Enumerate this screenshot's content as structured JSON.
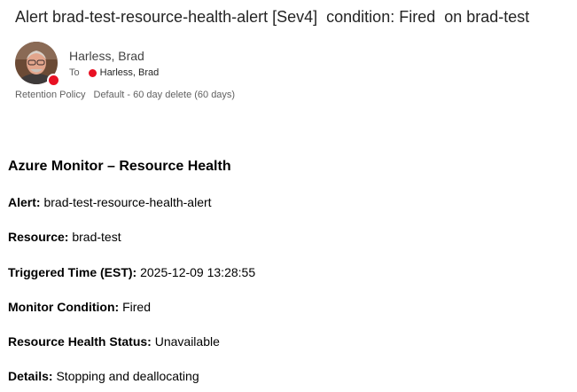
{
  "email": {
    "subject": "Alert brad-test-resource-health-alert [Sev4]  condition: Fired  on brad-test",
    "sender": {
      "name": "Harless, Brad",
      "presence_color": "#e81123"
    },
    "to": {
      "label": "To",
      "recipient": "Harless, Brad"
    },
    "retention": {
      "label": "Retention Policy",
      "value": "Default - 60 day delete (60 days)"
    }
  },
  "body": {
    "heading": "Azure Monitor – Resource Health",
    "fields": [
      {
        "key": "Alert:",
        "value": "brad-test-resource-health-alert"
      },
      {
        "key": "Resource:",
        "value": "brad-test"
      },
      {
        "key": "Triggered Time (EST):",
        "value": "2025-12-09 13:28:55"
      },
      {
        "key": "Monitor Condition:",
        "value": "Fired"
      },
      {
        "key": "Resource Health Status:",
        "value": "Unavailable"
      },
      {
        "key": "Details:",
        "value": "Stopping and deallocating"
      }
    ]
  }
}
